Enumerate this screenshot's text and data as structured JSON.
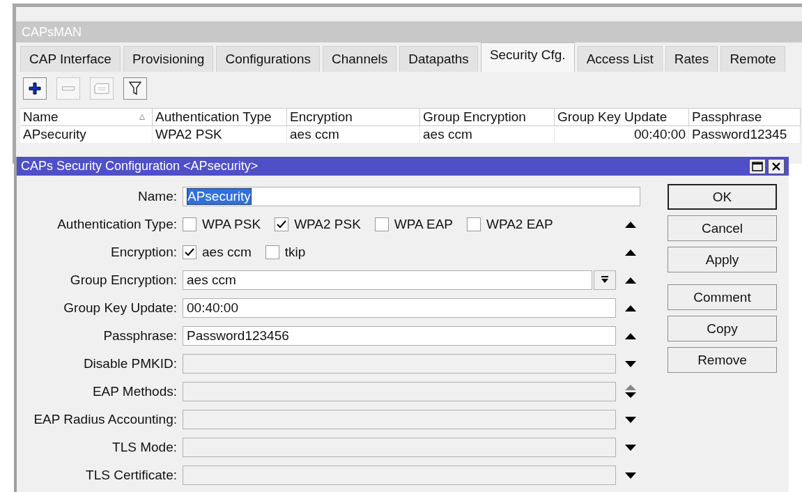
{
  "window": {
    "title": "CAPsMAN"
  },
  "tabs": [
    {
      "label": "CAP Interface",
      "selected": false
    },
    {
      "label": "Provisioning",
      "selected": false
    },
    {
      "label": "Configurations",
      "selected": false
    },
    {
      "label": "Channels",
      "selected": false
    },
    {
      "label": "Datapaths",
      "selected": false
    },
    {
      "label": "Security Cfg.",
      "selected": true
    },
    {
      "label": "Access List",
      "selected": false
    },
    {
      "label": "Rates",
      "selected": false
    },
    {
      "label": "Remote",
      "selected": false
    }
  ],
  "toolbar": [
    {
      "kind": "add",
      "disabled": false
    },
    {
      "kind": "remove",
      "disabled": true
    },
    {
      "kind": "comment",
      "disabled": true
    },
    {
      "kind": "filter",
      "disabled": false
    }
  ],
  "table": {
    "columns": [
      {
        "label": "Name",
        "sorted": true
      },
      {
        "label": "Authentication Type",
        "sorted": false
      },
      {
        "label": "Encryption",
        "sorted": false
      },
      {
        "label": "Group Encryption",
        "sorted": false
      },
      {
        "label": "Group Key Update",
        "sorted": false
      },
      {
        "label": "Passphrase",
        "sorted": false
      }
    ],
    "rows": [
      {
        "cells": [
          "APsecurity",
          "WPA2 PSK",
          "aes ccm",
          "aes ccm",
          "00:40:00",
          "Password12345"
        ]
      }
    ]
  },
  "dialog": {
    "title": "CAPs Security Configuration <APsecurity>",
    "fields": [
      {
        "kind": "text",
        "label": "Name:",
        "value": "APsecurity",
        "text_selected": true,
        "disabled": false
      },
      {
        "kind": "checks",
        "label": "Authentication Type:",
        "toggle": {
          "kind": "up"
        },
        "options": [
          {
            "label": "WPA PSK",
            "checked": false
          },
          {
            "label": "WPA2 PSK",
            "checked": true
          },
          {
            "label": "WPA EAP",
            "checked": false
          },
          {
            "label": "WPA2 EAP",
            "checked": false
          }
        ]
      },
      {
        "kind": "checks",
        "label": "Encryption:",
        "toggle": {
          "kind": "up"
        },
        "options": [
          {
            "label": "aes ccm",
            "checked": true
          },
          {
            "label": "tkip",
            "checked": false
          }
        ]
      },
      {
        "kind": "combo",
        "label": "Group Encryption:",
        "value": "aes ccm",
        "toggle": {
          "kind": "up"
        },
        "disabled": false
      },
      {
        "kind": "text",
        "label": "Group Key Update:",
        "value": "00:40:00",
        "toggle": {
          "kind": "up"
        },
        "disabled": false
      },
      {
        "kind": "text",
        "label": "Passphrase:",
        "value": "Password123456",
        "toggle": {
          "kind": "up"
        },
        "disabled": false
      },
      {
        "kind": "text",
        "label": "Disable PMKID:",
        "toggle": {
          "kind": "down"
        },
        "disabled": true
      },
      {
        "kind": "text",
        "label": "EAP Methods:",
        "toggle": {
          "kind": "updown"
        },
        "disabled": true
      },
      {
        "kind": "text",
        "label": "EAP Radius Accounting:",
        "toggle": {
          "kind": "down"
        },
        "disabled": true
      },
      {
        "kind": "text",
        "label": "TLS Mode:",
        "toggle": {
          "kind": "down"
        },
        "disabled": true
      },
      {
        "kind": "text",
        "label": "TLS Certificate:",
        "toggle": {
          "kind": "down"
        },
        "disabled": true
      }
    ],
    "button_groups": [
      [
        {
          "label": "OK",
          "default": true
        },
        {
          "label": "Cancel",
          "default": false
        },
        {
          "label": "Apply",
          "default": false
        }
      ],
      [
        {
          "label": "Comment",
          "default": false
        },
        {
          "label": "Copy",
          "default": false
        },
        {
          "label": "Remove",
          "default": false
        }
      ]
    ]
  }
}
